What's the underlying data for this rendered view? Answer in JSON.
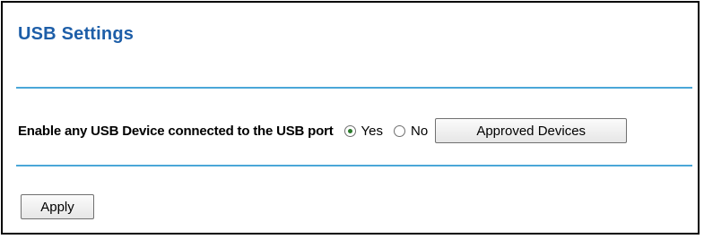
{
  "page": {
    "title": "USB Settings"
  },
  "usb": {
    "enable_label": "Enable any USB Device connected to the USB port",
    "options": [
      {
        "label": "Yes",
        "selected": true
      },
      {
        "label": "No",
        "selected": false
      }
    ],
    "approved_devices_label": "Approved Devices"
  },
  "actions": {
    "apply_label": "Apply"
  },
  "colors": {
    "title": "#1d5ea8",
    "divider": "#4aa7d8"
  }
}
